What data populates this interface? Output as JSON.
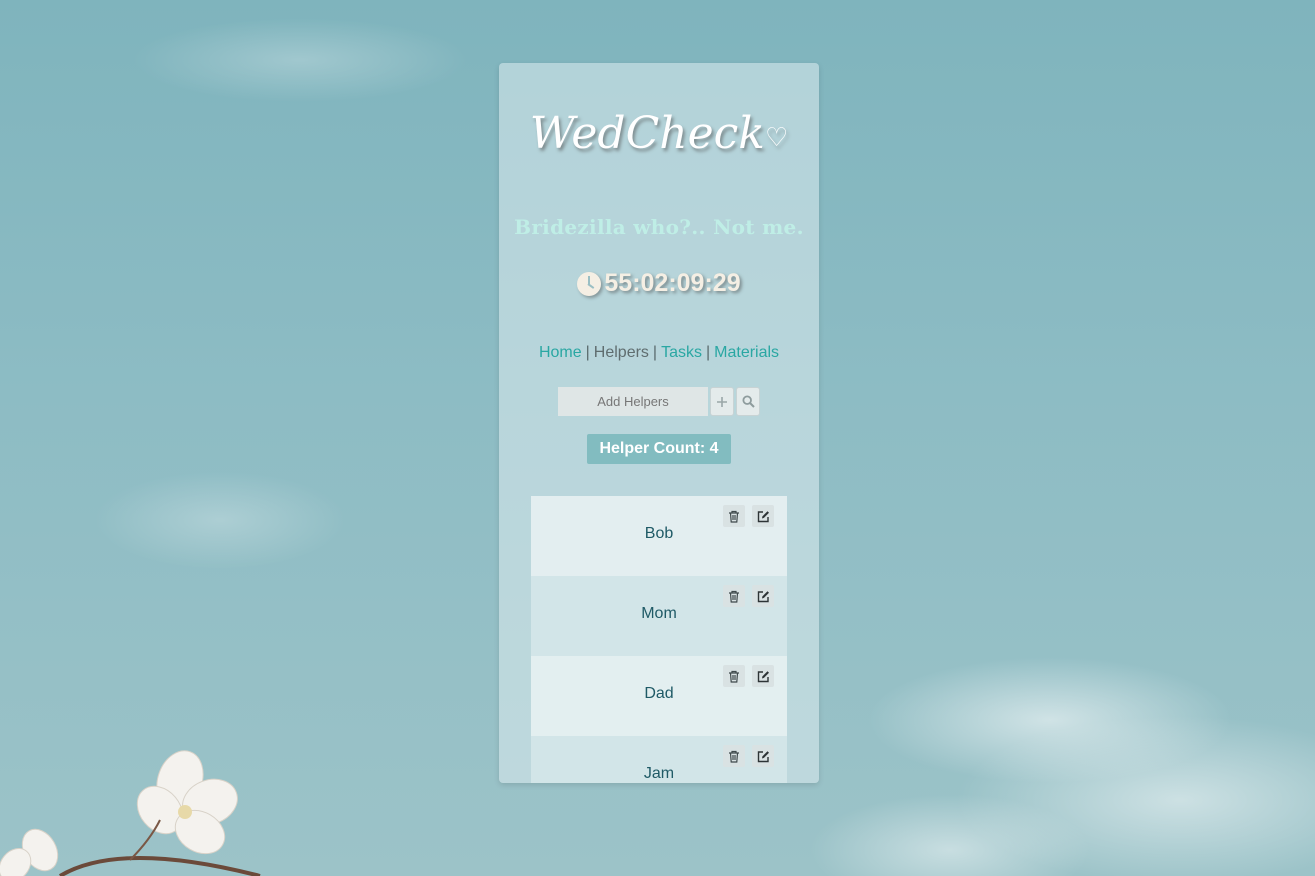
{
  "app": {
    "title": "WedCheck",
    "tagline": "Bridezilla who?.. Not me.",
    "countdown": "55:02:09:29"
  },
  "nav": {
    "items": [
      {
        "label": "Home",
        "active": false
      },
      {
        "label": "Helpers",
        "active": true
      },
      {
        "label": "Tasks",
        "active": false
      },
      {
        "label": "Materials",
        "active": false
      }
    ],
    "separator": "|"
  },
  "search": {
    "placeholder": "Add Helpers",
    "add_icon": "plus-icon",
    "search_icon": "search-icon"
  },
  "helper_count": "Helper Count: 4",
  "helpers": [
    {
      "name": "Bob"
    },
    {
      "name": "Mom"
    },
    {
      "name": "Dad"
    },
    {
      "name": "Jam"
    }
  ],
  "colors": {
    "accent": "#2aa7a3",
    "badge": "#82bcc0",
    "tagline": "#bfeee6",
    "helper_name": "#1f5a66"
  }
}
